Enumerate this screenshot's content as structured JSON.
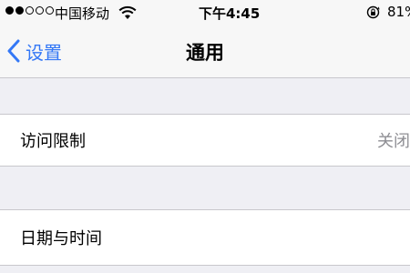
{
  "status_bar": {
    "carrier": "中国移动",
    "time": "下午4:45",
    "battery": "81%",
    "signal_bars_filled": 2,
    "signal_bars_total": 5
  },
  "nav": {
    "back_label": "设置",
    "title": "通用"
  },
  "rows": [
    {
      "label": "访问限制",
      "value": "关闭"
    },
    {
      "label": "日期与时间"
    }
  ],
  "colors": {
    "accent": "#3478f6",
    "background": "#efeff4",
    "bar": "#f7f7f7",
    "separator": "#c8c7cc",
    "secondary_text": "#8e8e93"
  }
}
